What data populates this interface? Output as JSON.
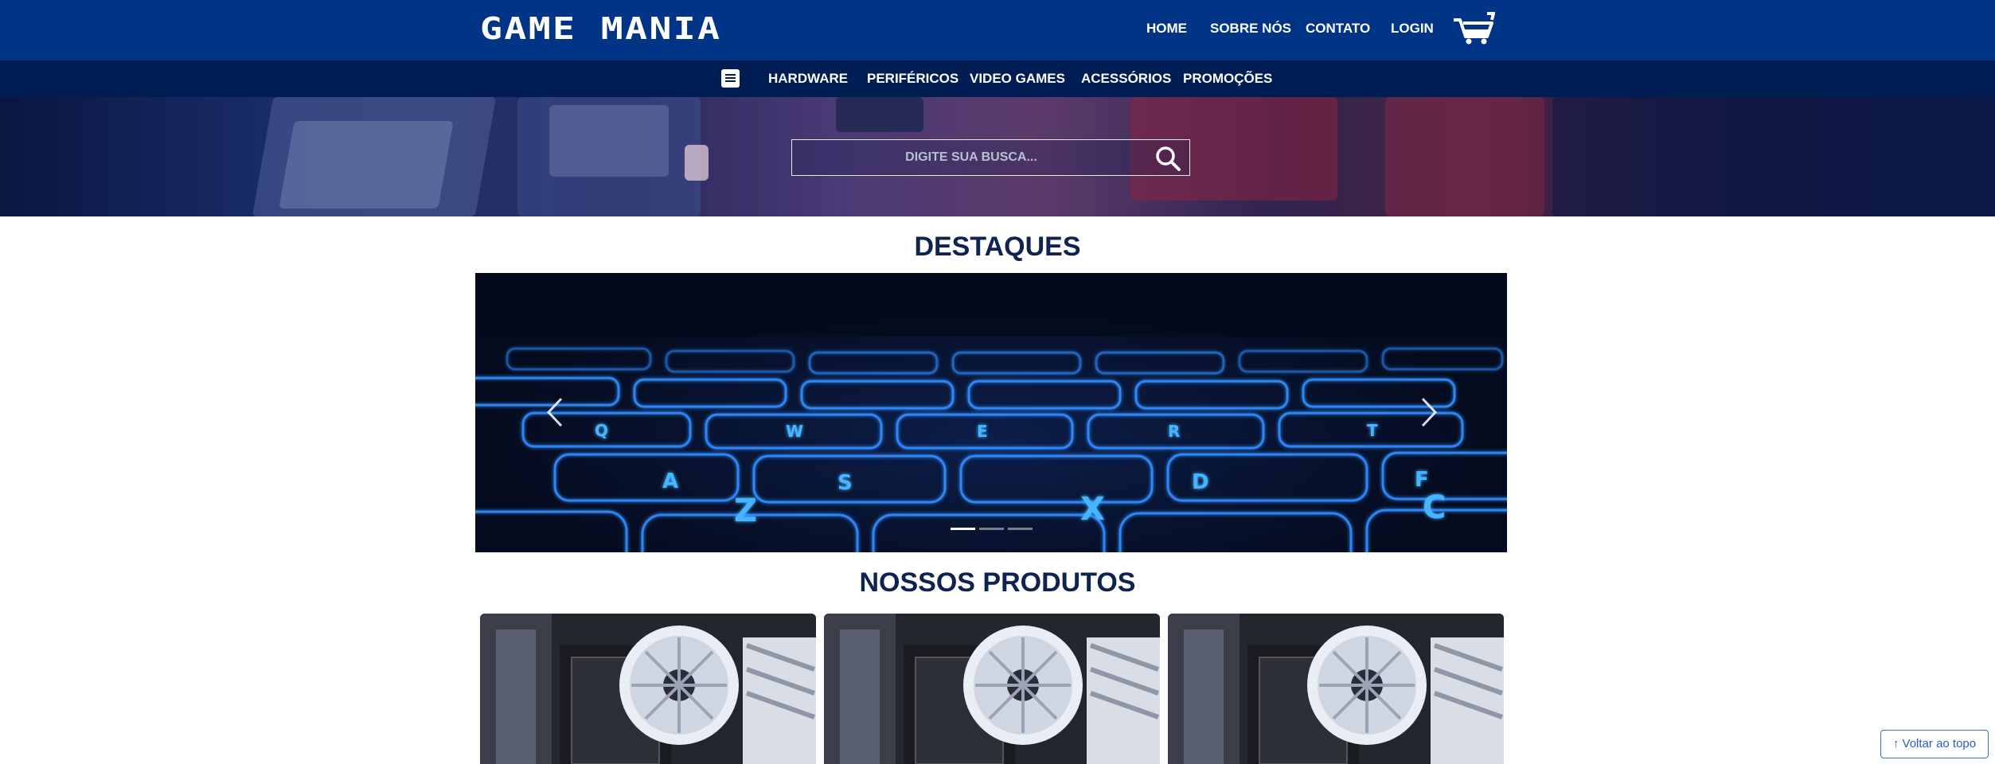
{
  "header": {
    "logo": "GAME MANIA",
    "nav": [
      "HOME",
      "SOBRE NÓS",
      "CONTATO",
      "LOGIN"
    ],
    "cart_icon": "shopping-cart-icon"
  },
  "categories": {
    "menu_icon": "menu-icon",
    "items": [
      "HARDWARE",
      "PERIFÉRICOS",
      "VIDEO GAMES",
      "ACESSÓRIOS",
      "PROMOÇÕES"
    ]
  },
  "hero": {
    "search_placeholder": "DIGITE SUA BUSCA...",
    "search_icon": "search-icon"
  },
  "featured": {
    "title": "DESTAQUES",
    "carousel": {
      "key_letters": [
        "Q",
        "W",
        "E",
        "R",
        "T",
        "A",
        "S",
        "D",
        "F",
        "Z",
        "X",
        "C"
      ],
      "slide_count": 3,
      "active_slide": 1
    }
  },
  "products": {
    "title": "NOSSOS PRODUTOS",
    "count": 3
  },
  "back_to_top": "↑ Voltar ao topo",
  "colors": {
    "header": "#003487",
    "category_bar": "#001e53",
    "title": "#0e2352",
    "key_glow": "#2ea3ff"
  }
}
